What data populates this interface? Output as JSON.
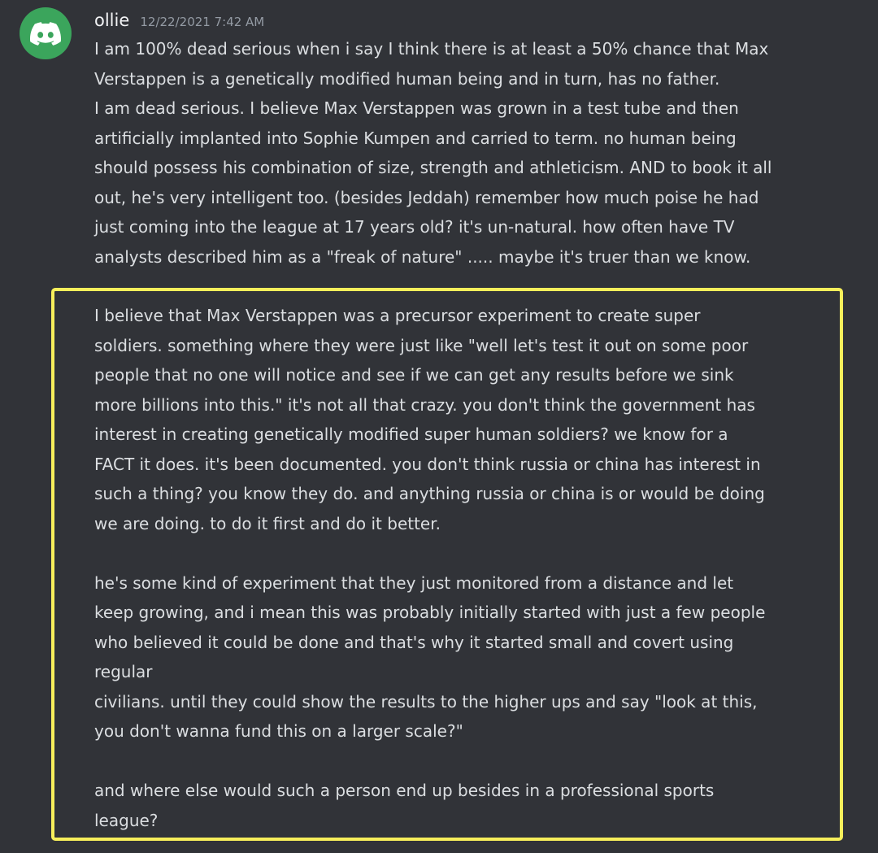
{
  "message": {
    "author": "ollie",
    "timestamp": "12/22/2021 7:42 AM",
    "avatar_icon": "discord-logo-icon",
    "avatar_color": "#3ba55c",
    "first_paragraph": "I am 100% dead serious when i say I think there is at least a 50% chance that Max\nVerstappen is a genetically modified human being and in turn, has no father.\nI am dead serious. I believe Max Verstappen was grown in a test tube and then\nartificially implanted into Sophie Kumpen and carried to term. no human being\nshould possess his combination of size, strength and athleticism. AND to book it all\nout, he's very intelligent too. (besides Jeddah) remember how much poise he had\njust coming into the league at 17 years old? it's un-natural. how often have TV\nanalysts described him as a \"freak of nature\" ..... maybe it's truer than we know.",
    "highlighted_text": "I believe that Max Verstappen was a precursor experiment to create super\nsoldiers. something where they were just like \"well let's test it out on some poor\npeople that no one will notice and see if we can get any results before we sink\nmore billions into this.\" it's not all that crazy. you don't think the government has\ninterest in creating genetically modified super human soldiers? we know for a\nFACT it does. it's been documented. you don't think russia or china has interest in\nsuch a thing? you know they do. and anything russia or china is or would be doing\nwe are doing. to do it first and do it better.\n\nhe's some kind of experiment that they just monitored from a distance and let\nkeep growing, and i mean this was probably initially started with just a few people\nwho believed it could be done and that's why it started small and covert using\nregular\ncivilians. until they could show the results to the higher ups and say \"look at this,\nyou don't wanna fund this on a larger scale?\"\n\nand where else would such a person end up besides in a professional sports\nleague?",
    "highlight_color": "#f7ef5b"
  }
}
